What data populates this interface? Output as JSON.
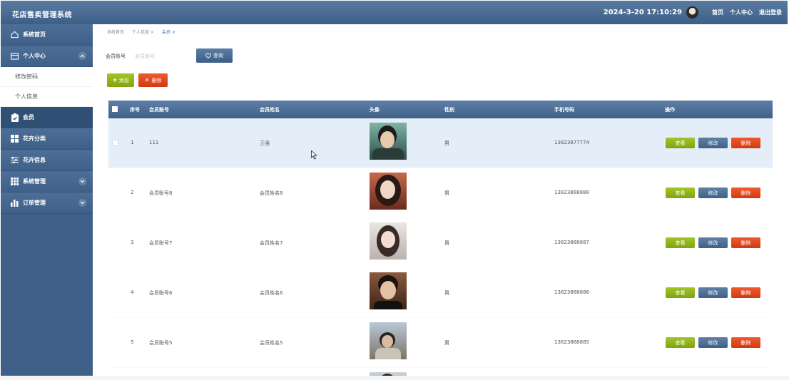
{
  "header": {
    "title": "花店售卖管理系统",
    "datetime": "2024-3-20 17:10:29",
    "links": [
      "首页",
      "个人中心",
      "退出登录"
    ]
  },
  "sidebar": {
    "items": [
      {
        "label": "系统首页",
        "icon": "home-icon"
      },
      {
        "label": "个人中心",
        "icon": "card-icon",
        "expanded": true,
        "children": [
          "修改密码",
          "个人信息"
        ]
      },
      {
        "label": "会员",
        "icon": "clipboard-check-icon",
        "active": true
      },
      {
        "label": "花卉分类",
        "icon": "grid-icon"
      },
      {
        "label": "花卉信息",
        "icon": "sliders-icon"
      },
      {
        "label": "系统管理",
        "icon": "apps-icon",
        "collapsible": true
      },
      {
        "label": "订单管理",
        "icon": "bar-chart-icon",
        "collapsible": true
      }
    ]
  },
  "breadcrumb": [
    "系统首页",
    "个人信息 ×",
    "会员 ×"
  ],
  "search": {
    "label": "会员账号",
    "placeholder": "会员账号",
    "button": "查询"
  },
  "toolbar": {
    "add": "添加",
    "delete": "删除"
  },
  "table": {
    "columns": [
      "序号",
      "会员账号",
      "会员姓名",
      "头像",
      "性别",
      "手机号码",
      "操作"
    ],
    "actions": [
      "查看",
      "修改",
      "删除"
    ],
    "rows": [
      {
        "index": "1",
        "account": "111",
        "name": "王强",
        "gender": "男",
        "phone": "13823877774"
      },
      {
        "index": "2",
        "account": "会员账号8",
        "name": "会员姓名8",
        "gender": "男",
        "phone": "13823888888"
      },
      {
        "index": "3",
        "account": "会员账号7",
        "name": "会员姓名7",
        "gender": "男",
        "phone": "13823888887"
      },
      {
        "index": "4",
        "account": "会员账号6",
        "name": "会员姓名6",
        "gender": "男",
        "phone": "13823888886"
      },
      {
        "index": "5",
        "account": "会员账号5",
        "name": "会员姓名5",
        "gender": "男",
        "phone": "13823888885"
      }
    ]
  },
  "colors": {
    "header": "#3d5f87",
    "sidebar": "#3f6088",
    "green": "#8db31a",
    "red": "#e04a1e",
    "row_highlight": "#e3eef9"
  }
}
